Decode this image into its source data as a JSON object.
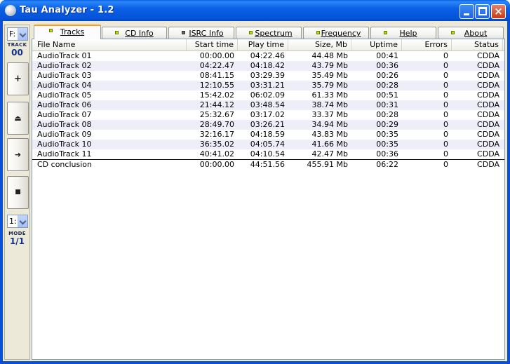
{
  "window": {
    "title": "Tau Analyzer - 1.2",
    "close_glyph": "×",
    "titlebar_color": "#0a5ee8"
  },
  "toolbar": {
    "drive_value": "F:",
    "track_caption": "TRACK",
    "track_value": "00",
    "buttons": [
      {
        "name": "add",
        "glyph": "+"
      },
      {
        "name": "eject",
        "glyph": "⏏"
      },
      {
        "name": "next",
        "glyph": "➜"
      },
      {
        "name": "stop",
        "glyph": "■"
      }
    ],
    "mode_select_value": "1:",
    "mode_caption": "MODE",
    "mode_value": "1/1"
  },
  "tabs": [
    {
      "label": "Tracks",
      "active": true,
      "led": "yellow-green"
    },
    {
      "label": "CD Info",
      "active": false,
      "led": "yellow-green"
    },
    {
      "label": "ISRC Info",
      "active": false,
      "led": "grey"
    },
    {
      "label": "Spectrum",
      "active": false,
      "led": "yellow-green"
    },
    {
      "label": "Frequency",
      "active": false,
      "led": "yellow-green"
    },
    {
      "label": "Help",
      "active": false,
      "led": "yellow-green"
    },
    {
      "label": "About",
      "active": false,
      "led": "yellow-green"
    }
  ],
  "table": {
    "columns": [
      "File Name",
      "Start time",
      "Play time",
      "Size, Mb",
      "Uptime",
      "Errors",
      "Status"
    ],
    "rows": [
      [
        "AudioTrack 01",
        "00:00.00",
        "04:22.46",
        "44.48 Mb",
        "00:41",
        "0",
        "CDDA"
      ],
      [
        "AudioTrack 02",
        "04:22.47",
        "04:18.42",
        "43.79 Mb",
        "00:36",
        "0",
        "CDDA"
      ],
      [
        "AudioTrack 03",
        "08:41.15",
        "03:29.39",
        "35.49 Mb",
        "00:26",
        "0",
        "CDDA"
      ],
      [
        "AudioTrack 04",
        "12:10.55",
        "03:31.21",
        "35.79 Mb",
        "00:28",
        "0",
        "CDDA"
      ],
      [
        "AudioTrack 05",
        "15:42.02",
        "06:02.09",
        "61.33 Mb",
        "00:51",
        "0",
        "CDDA"
      ],
      [
        "AudioTrack 06",
        "21:44.12",
        "03:48.54",
        "38.74 Mb",
        "00:31",
        "0",
        "CDDA"
      ],
      [
        "AudioTrack 07",
        "25:32.67",
        "03:17.02",
        "33.37 Mb",
        "00:28",
        "0",
        "CDDA"
      ],
      [
        "AudioTrack 08",
        "28:49.70",
        "03:26.21",
        "34.94 Mb",
        "00:29",
        "0",
        "CDDA"
      ],
      [
        "AudioTrack 09",
        "32:16.17",
        "04:18.59",
        "43.83 Mb",
        "00:35",
        "0",
        "CDDA"
      ],
      [
        "AudioTrack 10",
        "36:35.02",
        "04:05.74",
        "41.66 Mb",
        "00:35",
        "0",
        "CDDA"
      ],
      [
        "AudioTrack 11",
        "40:41.02",
        "04:10.54",
        "42.47 Mb",
        "00:36",
        "0",
        "CDDA"
      ]
    ],
    "summary": [
      "CD conclusion",
      "00:00.00",
      "44:51.56",
      "455.91 Mb",
      "06:22",
      "0",
      "CDDA"
    ]
  }
}
